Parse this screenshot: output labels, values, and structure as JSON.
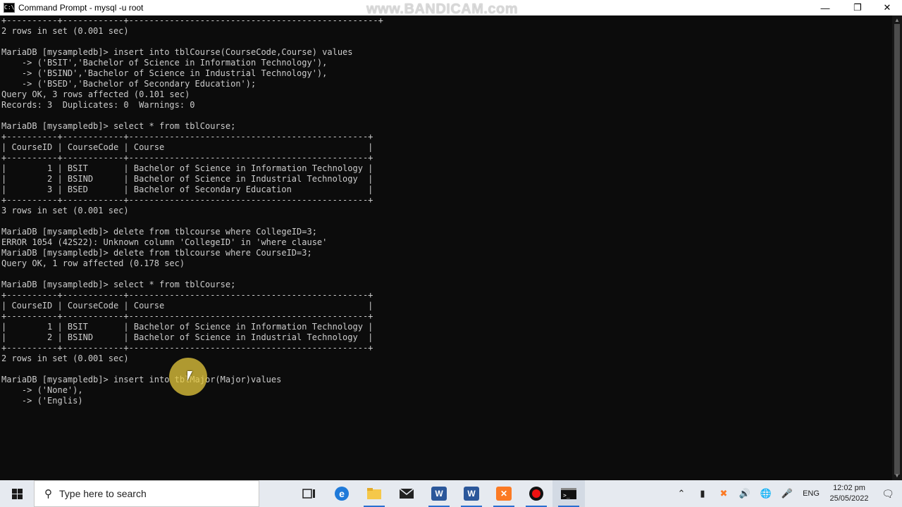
{
  "window": {
    "title": "Command Prompt - mysql  -u root",
    "watermark": "www.BANDICAM.com",
    "minimize": "—",
    "restore": "❐",
    "close": "✕"
  },
  "console": {
    "lines": [
      "+----------+------------+-------------------------------------------------+",
      "2 rows in set (0.001 sec)",
      "",
      "MariaDB [mysampledb]> insert into tblCourse(CourseCode,Course) values",
      "    -> ('BSIT','Bachelor of Science in Information Technology'),",
      "    -> ('BSIND','Bachelor of Science in Industrial Technology'),",
      "    -> ('BSED','Bachelor of Secondary Education');",
      "Query OK, 3 rows affected (0.101 sec)",
      "Records: 3  Duplicates: 0  Warnings: 0",
      "",
      "MariaDB [mysampledb]> select * from tblCourse;",
      "+----------+------------+-----------------------------------------------+",
      "| CourseID | CourseCode | Course                                        |",
      "+----------+------------+-----------------------------------------------+",
      "|        1 | BSIT       | Bachelor of Science in Information Technology |",
      "|        2 | BSIND      | Bachelor of Science in Industrial Technology  |",
      "|        3 | BSED       | Bachelor of Secondary Education               |",
      "+----------+------------+-----------------------------------------------+",
      "3 rows in set (0.001 sec)",
      "",
      "MariaDB [mysampledb]> delete from tblcourse where CollegeID=3;",
      "ERROR 1054 (42S22): Unknown column 'CollegeID' in 'where clause'",
      "MariaDB [mysampledb]> delete from tblcourse where CourseID=3;",
      "Query OK, 1 row affected (0.178 sec)",
      "",
      "MariaDB [mysampledb]> select * from tblCourse;",
      "+----------+------------+-----------------------------------------------+",
      "| CourseID | CourseCode | Course                                        |",
      "+----------+------------+-----------------------------------------------+",
      "|        1 | BSIT       | Bachelor of Science in Information Technology |",
      "|        2 | BSIND      | Bachelor of Science in Industrial Technology  |",
      "+----------+------------+-----------------------------------------------+",
      "2 rows in set (0.001 sec)",
      "",
      "MariaDB [mysampledb]> insert into tblMajor(Major)values",
      "    -> ('None'),",
      "    -> ('Englis)"
    ]
  },
  "taskbar": {
    "search_placeholder": "Type here to search",
    "lang": "ENG",
    "time": "12:02 pm",
    "date": "25/05/2022"
  },
  "colors": {
    "console_bg": "#0c0c0c",
    "console_text": "#cccccc",
    "taskbar_bg": "#e6eaf0"
  }
}
